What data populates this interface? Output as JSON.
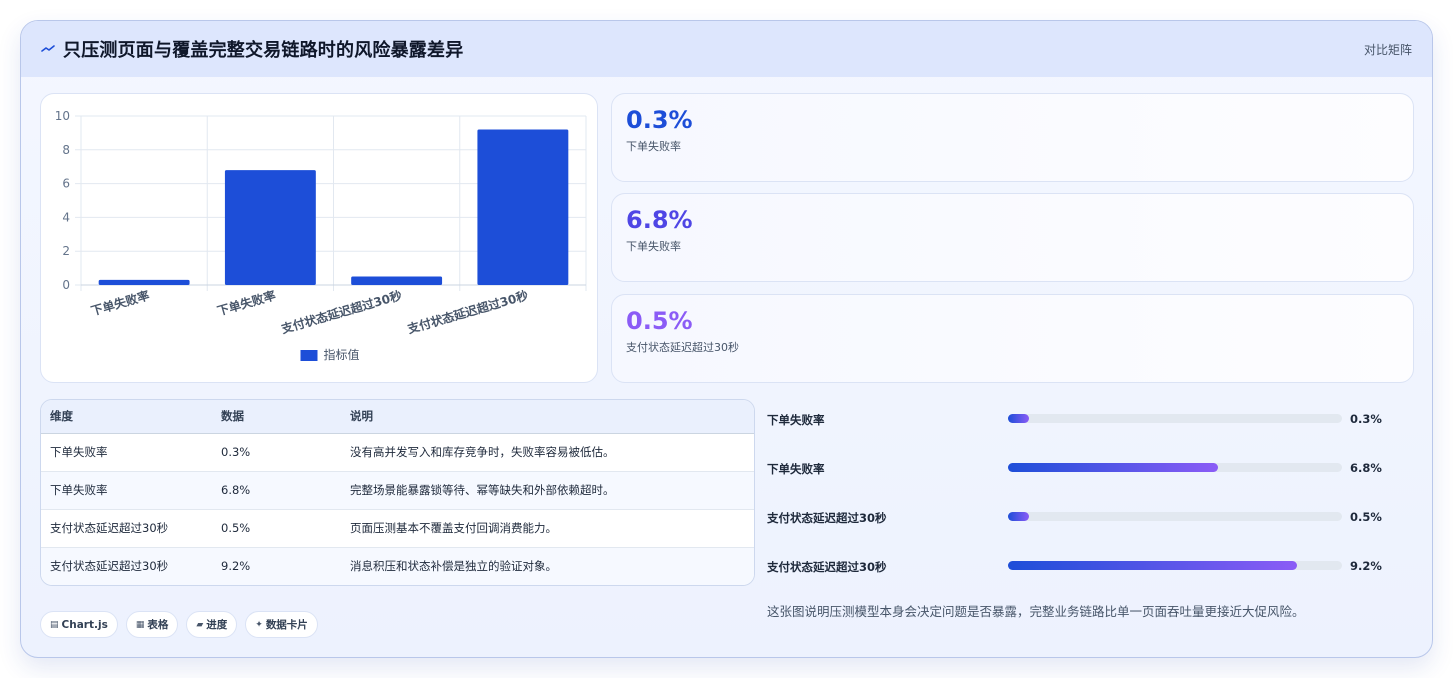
{
  "header": {
    "title": "只压测页面与覆盖完整交易链路时的风险暴露差异",
    "tag": "对比矩阵"
  },
  "chart_data": {
    "type": "bar",
    "categories": [
      "下单失败率",
      "下单失败率",
      "支付状态延迟超过30秒",
      "支付状态延迟超过30秒"
    ],
    "series": [
      {
        "name": "指标值",
        "values": [
          0.3,
          6.8,
          0.5,
          9.2
        ],
        "color": "#1d4ed8"
      }
    ],
    "ylim": [
      0,
      10
    ],
    "yticks": [
      0,
      2,
      4,
      6,
      8,
      10
    ],
    "grid": true,
    "legend": "bottom"
  },
  "stats": [
    {
      "value": "0.3%",
      "label": "下单失败率",
      "color": "#1d4ed8"
    },
    {
      "value": "6.8%",
      "label": "下单失败率",
      "color": "#4f46e5"
    },
    {
      "value": "0.5%",
      "label": "支付状态延迟超过30秒",
      "color": "#8b5cf6"
    }
  ],
  "table": {
    "headers": [
      "维度",
      "数据",
      "说明"
    ],
    "rows": [
      [
        "下单失败率",
        "0.3%",
        "没有高并发写入和库存竞争时，失败率容易被低估。"
      ],
      [
        "下单失败率",
        "6.8%",
        "完整场景能暴露锁等待、幂等缺失和外部依赖超时。"
      ],
      [
        "支付状态延迟超过30秒",
        "0.5%",
        "页面压测基本不覆盖支付回调消费能力。"
      ],
      [
        "支付状态延迟超过30秒",
        "9.2%",
        "消息积压和状态补偿是独立的验证对象。"
      ]
    ]
  },
  "progress": [
    {
      "label": "下单失败率",
      "value": "0.3%",
      "fraction": 0.063
    },
    {
      "label": "下单失败率",
      "value": "6.8%",
      "fraction": 0.63
    },
    {
      "label": "支付状态延迟超过30秒",
      "value": "0.5%",
      "fraction": 0.063
    },
    {
      "label": "支付状态延迟超过30秒",
      "value": "9.2%",
      "fraction": 0.865
    }
  ],
  "note": "这张图说明压测模型本身会决定问题是否暴露，完整业务链路比单一页面吞吐量更接近大促风险。",
  "chips": [
    {
      "icon": "chart-icon",
      "glyph": "▤",
      "label": "Chart.js"
    },
    {
      "icon": "table-icon",
      "glyph": "▦",
      "label": "表格"
    },
    {
      "icon": "progress-icon",
      "glyph": "▰",
      "label": "进度"
    },
    {
      "icon": "sparkle-icon",
      "glyph": "✦",
      "label": "数据卡片"
    }
  ]
}
